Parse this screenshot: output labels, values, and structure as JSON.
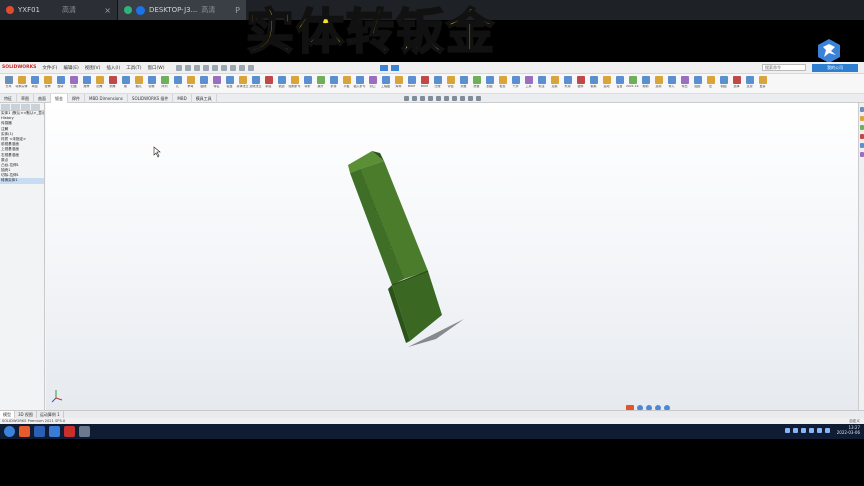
{
  "browser_tabs": [
    {
      "title": "YXF01",
      "caption": "高清",
      "dot_color": "#e34b2c"
    },
    {
      "title": "DESKTOP-J3...",
      "caption": "高清",
      "dot_color": "#2fb37a"
    }
  ],
  "tab_extra": "P",
  "overlay_title": "实体转钣金",
  "menubar": {
    "logo": "SOLIDWORKS",
    "items": [
      "文件(F)",
      "编辑(E)",
      "视图(V)",
      "插入(I)",
      "工具(T)",
      "窗口(W)"
    ],
    "search_placeholder": "搜索命令",
    "right_button": "我的公司"
  },
  "ribbon_buttons": [
    {
      "label": "分离",
      "color": "#6b8fb8"
    },
    {
      "label": "转换实体",
      "color": "#d9a43b"
    },
    {
      "label": "草图",
      "color": "#5b8fd0"
    },
    {
      "label": "拉伸",
      "color": "#d9a43b"
    },
    {
      "label": "旋转",
      "color": "#5b8fd0"
    },
    {
      "label": "扫描",
      "color": "#9a6fc0"
    },
    {
      "label": "放样",
      "color": "#5b8fd0"
    },
    {
      "label": "圆角",
      "color": "#d9a43b"
    },
    {
      "label": "倒角",
      "color": "#c04848"
    },
    {
      "label": "筋",
      "color": "#5b8fd0"
    },
    {
      "label": "抽壳",
      "color": "#d9a43b"
    },
    {
      "label": "镜像",
      "color": "#5b8fd0"
    },
    {
      "label": "阵列",
      "color": "#6fae5a"
    },
    {
      "label": "孔",
      "color": "#5b8fd0"
    },
    {
      "label": "参考",
      "color": "#d9a43b"
    },
    {
      "label": "曲线",
      "color": "#5b8fd0"
    },
    {
      "label": "特征",
      "color": "#9a6fc0"
    },
    {
      "label": "钣金",
      "color": "#5b8fd0"
    },
    {
      "label": "基体法兰",
      "color": "#d9a43b"
    },
    {
      "label": "边线法兰",
      "color": "#5b8fd0"
    },
    {
      "label": "斜接",
      "color": "#c04848"
    },
    {
      "label": "褶边",
      "color": "#5b8fd0"
    },
    {
      "label": "绘制折弯",
      "color": "#d9a43b"
    },
    {
      "label": "转折",
      "color": "#5b8fd0"
    },
    {
      "label": "展开",
      "color": "#6fae5a"
    },
    {
      "label": "折叠",
      "color": "#5b8fd0"
    },
    {
      "label": "平板",
      "color": "#d9a43b"
    },
    {
      "label": "插入折弯",
      "color": "#5b8fd0"
    },
    {
      "label": "切口",
      "color": "#9a6fc0"
    },
    {
      "label": "工程图",
      "color": "#5b8fd0"
    },
    {
      "label": "焊件",
      "color": "#d9a43b"
    },
    {
      "label": "BOM",
      "color": "#5b8fd0"
    },
    {
      "label": "BOM",
      "color": "#c04848"
    },
    {
      "label": "比较",
      "color": "#5b8fd0"
    },
    {
      "label": "评估",
      "color": "#d9a43b"
    },
    {
      "label": "测量",
      "color": "#5b8fd0"
    },
    {
      "label": "质量",
      "color": "#6fae5a"
    },
    {
      "label": "剖面",
      "color": "#5b8fd0"
    },
    {
      "label": "检查",
      "color": "#d9a43b"
    },
    {
      "label": "干涉",
      "color": "#5b8fd0"
    },
    {
      "label": "工具",
      "color": "#9a6fc0"
    },
    {
      "label": "标注",
      "color": "#5b8fd0"
    },
    {
      "label": "渲染",
      "color": "#d9a43b"
    },
    {
      "label": "外观",
      "color": "#5b8fd0"
    },
    {
      "label": "插件",
      "color": "#c04848"
    },
    {
      "label": "模拟",
      "color": "#5b8fd0"
    },
    {
      "label": "运动",
      "color": "#d9a43b"
    },
    {
      "label": "设置",
      "color": "#5b8fd0"
    },
    {
      "label": "2021-12-7",
      "color": "#6fae5a"
    },
    {
      "label": "帮助",
      "color": "#5b8fd0"
    },
    {
      "label": "选项",
      "color": "#d9a43b"
    },
    {
      "label": "导入",
      "color": "#5b8fd0"
    },
    {
      "label": "导出",
      "color": "#9a6fc0"
    },
    {
      "label": "图层",
      "color": "#5b8fd0"
    },
    {
      "label": "宏",
      "color": "#d9a43b"
    },
    {
      "label": "视图",
      "color": "#5b8fd0"
    },
    {
      "label": "选择",
      "color": "#c04848"
    },
    {
      "label": "过滤",
      "color": "#5b8fd0"
    },
    {
      "label": "更多",
      "color": "#d9a43b"
    }
  ],
  "command_tabs": [
    "特征",
    "草图",
    "曲面",
    "钣金",
    "焊件",
    "MBD Dimensions",
    "SOLIDWORKS 插件",
    "MBD",
    "模具工具"
  ],
  "command_tab_active": 3,
  "tree_items": [
    "实体1 (默认<<默认>_显示状态 1>)",
    "History",
    "传感器",
    "注解",
    "实体(1)",
    "材质 <未指定>",
    "前视基准面",
    "上视基准面",
    "右视基准面",
    "原点",
    "凸台-拉伸1",
    "抽壳1",
    "切除-拉伸1",
    "转换实体1"
  ],
  "tree_selected": 13,
  "bottom_tabs": [
    "模型",
    "3D 视图",
    "运动算例 1"
  ],
  "bottom_tab_active": 0,
  "status_left": "SOLIDWORKS Premium 2021 SP5.0",
  "status_right": "自定义",
  "clock_time": "13:27",
  "clock_date": "2022-03-06",
  "colors": {
    "part_face": "#3f6f26",
    "part_dark": "#2d5418",
    "part_light": "#5a8f36",
    "taskbar": "#0f1c33",
    "overlay_text": "#f7e227"
  }
}
